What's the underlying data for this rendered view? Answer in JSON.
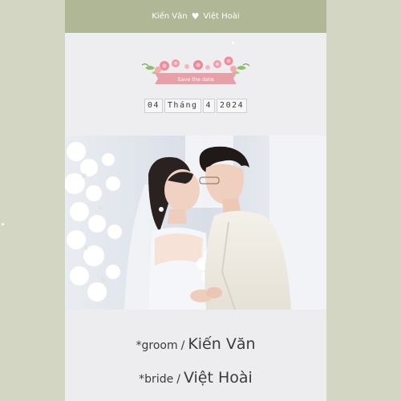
{
  "header": {
    "groom_short": "Kiến Văn",
    "heart_icon": "heart-icon",
    "bride_short": "Việt Hoài"
  },
  "save_the_date": {
    "banner_text": "Save the date",
    "date_parts": [
      "04",
      "Tháng",
      "4",
      "2024"
    ]
  },
  "photo": {
    "description_icon": "wedding-photo"
  },
  "names": {
    "groom_role": "*groom",
    "bride_role": "*bride",
    "separator": "/",
    "groom_name": "Kiến Văn",
    "bride_name": "Việt Hoài"
  },
  "colors": {
    "page_bg": "#d3d6c2",
    "topbar_bg": "#b0b797",
    "ribbon": "#e8a0a8",
    "card_bg": "#ececee"
  }
}
